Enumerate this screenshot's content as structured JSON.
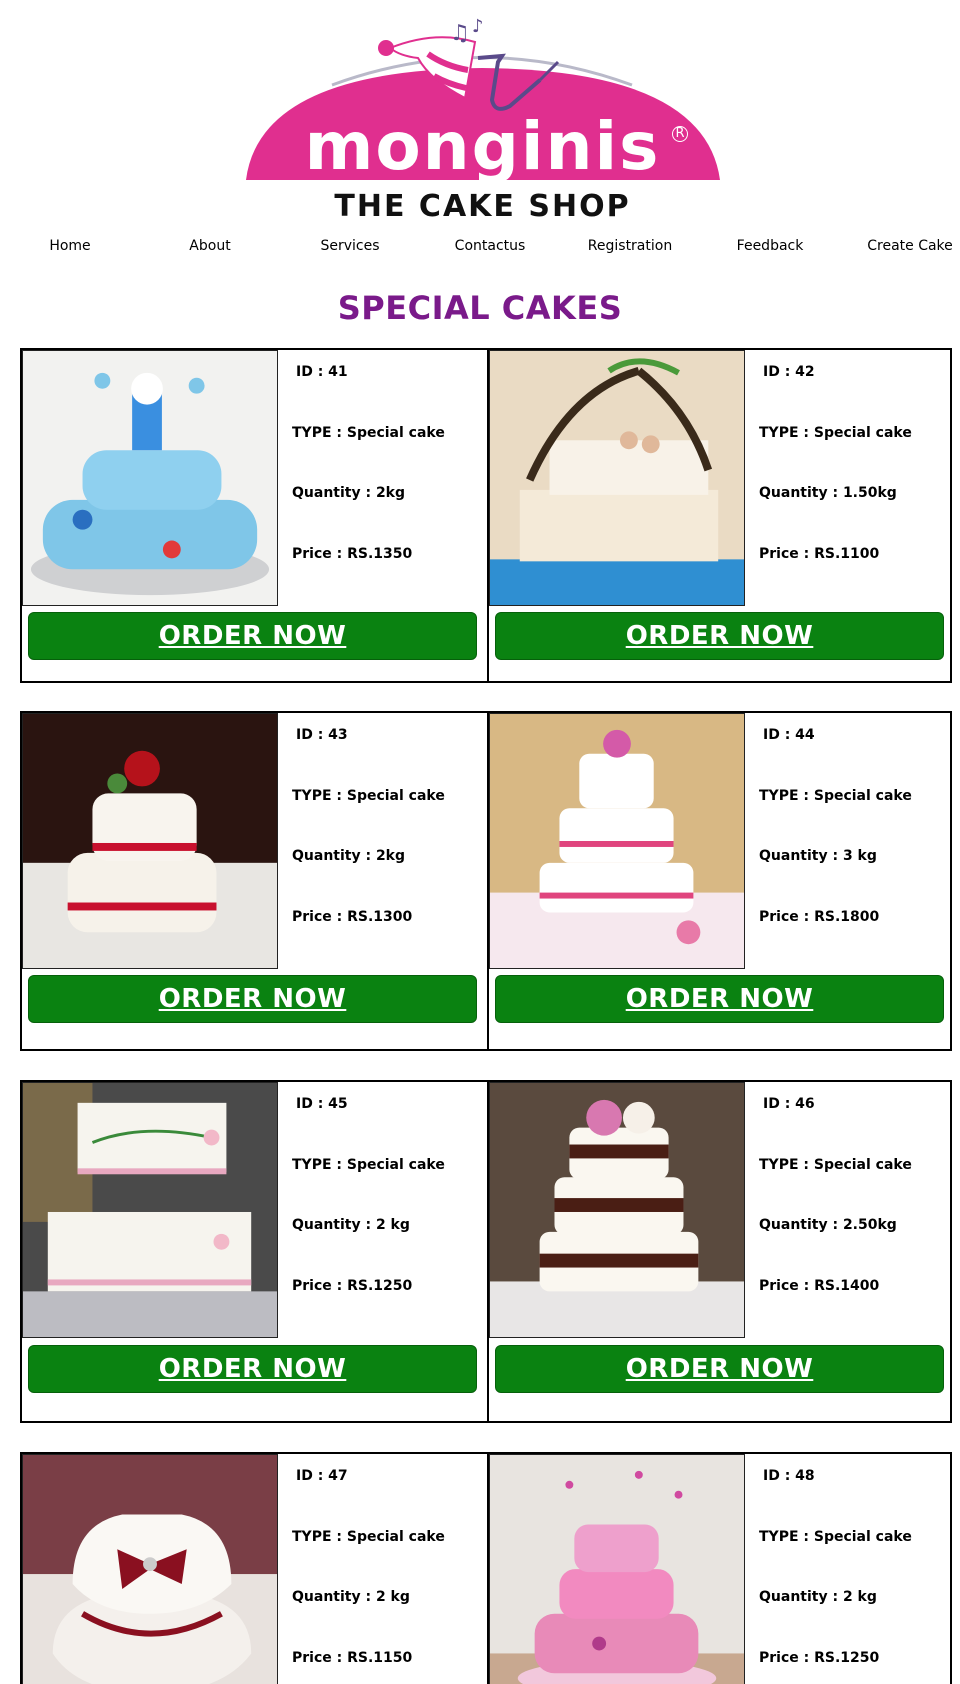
{
  "brand": {
    "name": "monginis",
    "tagline": "THE CAKE SHOP",
    "colors": {
      "pink": "#e02f8f",
      "title_purple": "#7a1a8a",
      "button_green": "#0a8211"
    }
  },
  "nav": {
    "items": [
      {
        "label": "Home"
      },
      {
        "label": "About"
      },
      {
        "label": "Services"
      },
      {
        "label": "Contactus"
      },
      {
        "label": "Registration"
      },
      {
        "label": "Feedback"
      },
      {
        "label": "Create Cake"
      }
    ]
  },
  "page": {
    "title": "SPECIAL CAKES"
  },
  "order_label": "ORDER NOW",
  "cakes": [
    {
      "id": "ID : 41",
      "type": "TYPE : Special cake",
      "quantity": "Quantity : 2kg",
      "price": "Price : RS.1350"
    },
    {
      "id": "ID : 42",
      "type": "TYPE : Special cake",
      "quantity": "Quantity : 1.50kg",
      "price": "Price : RS.1100"
    },
    {
      "id": "ID : 43",
      "type": "TYPE : Special cake",
      "quantity": "Quantity : 2kg",
      "price": "Price : RS.1300"
    },
    {
      "id": "ID : 44",
      "type": "TYPE : Special cake",
      "quantity": "Quantity : 3 kg",
      "price": "Price : RS.1800"
    },
    {
      "id": "ID : 45",
      "type": "TYPE : Special cake",
      "quantity": "Quantity : 2 kg",
      "price": "Price : RS.1250"
    },
    {
      "id": "ID : 46",
      "type": "TYPE : Special cake",
      "quantity": "Quantity : 2.50kg",
      "price": "Price : RS.1400"
    },
    {
      "id": "ID : 47",
      "type": "TYPE : Special cake",
      "quantity": "Quantity : 2 kg",
      "price": "Price : RS.1150"
    },
    {
      "id": "ID : 48",
      "type": "TYPE : Special cake",
      "quantity": "Quantity : 2 kg",
      "price": "Price : RS.1250"
    }
  ]
}
